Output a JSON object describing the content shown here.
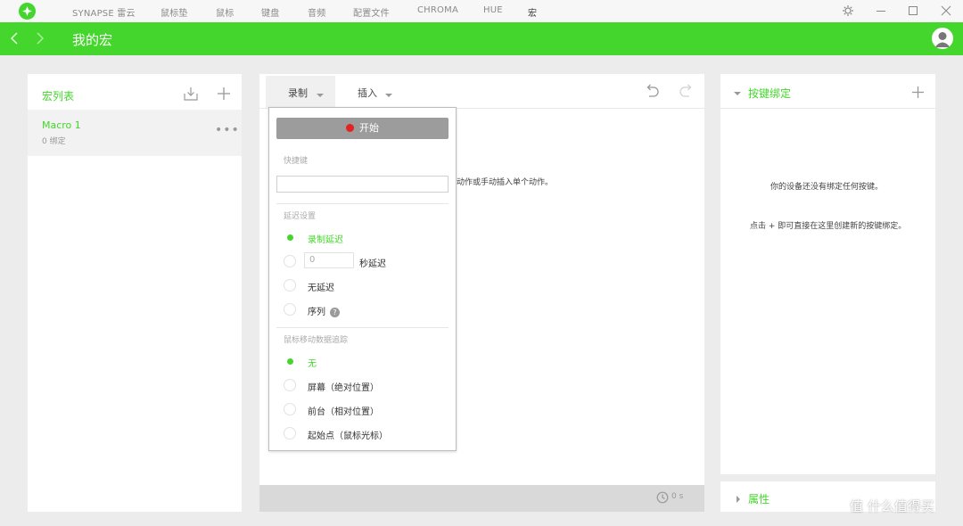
{
  "titlebar": {
    "nav": [
      "SYNAPSE 雷云",
      "鼠标垫",
      "鼠标",
      "键盘",
      "音频",
      "配置文件",
      "CHROMA",
      "HUE",
      "宏"
    ],
    "active_index": 8
  },
  "header": {
    "title": "我的宏"
  },
  "macro_list": {
    "title": "宏列表",
    "items": [
      {
        "name": "Macro 1",
        "sub": "0 绑定"
      }
    ]
  },
  "editor": {
    "tabs": {
      "record": "录制",
      "insert": "插入"
    },
    "hint_visible_fragment": "动作或手动插入单个动作。",
    "footer_time": "0 s"
  },
  "record_menu": {
    "start_label": "开始",
    "hotkey_section": "快捷键",
    "hotkey_value": "",
    "delay_section": "延迟设置",
    "delay_options": [
      "录制延迟",
      "秒延迟",
      "无延迟",
      "序列"
    ],
    "delay_selected": 0,
    "delay_seconds_value": "0",
    "tracking_section": "鼠标移动数据追踪",
    "tracking_options": [
      "无",
      "屏幕（绝对位置）",
      "前台（相对位置）",
      "起始点（鼠标光标）"
    ],
    "tracking_selected": 0
  },
  "bindings": {
    "title": "按键绑定",
    "empty_line1": "你的设备还没有绑定任何按键。",
    "empty_line2": "点击 + 即可直接在这里创建新的按键绑定。"
  },
  "properties": {
    "title": "属性"
  },
  "watermark": "值 什么值得买",
  "colors": {
    "accent": "#44d62c",
    "record_dot": "#e32222",
    "start_button": "#9c9c9c"
  }
}
